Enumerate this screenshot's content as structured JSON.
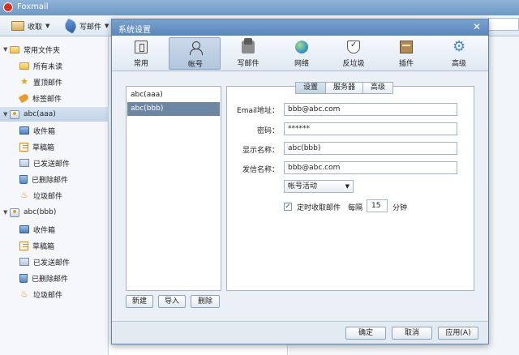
{
  "app": {
    "title": "Foxmail"
  },
  "toolbar": {
    "receive_label": "收取",
    "compose_label": "写邮件"
  },
  "sidebar": {
    "common_group": "常用文件夹",
    "common_items": [
      "所有未读",
      "置顶邮件",
      "标签邮件"
    ],
    "accounts": [
      {
        "name": "abc(aaa)",
        "folders": [
          "收件箱",
          "草稿箱",
          "已发送邮件",
          "已删除邮件",
          "垃圾邮件"
        ]
      },
      {
        "name": "abc(bbb)",
        "folders": [
          "收件箱",
          "草稿箱",
          "已发送邮件",
          "已删除邮件",
          "垃圾邮件"
        ]
      }
    ]
  },
  "dialog": {
    "title": "系统设置",
    "tabs": [
      {
        "label": "常用",
        "icon": "settings-common-icon"
      },
      {
        "label": "帐号",
        "icon": "account-icon"
      },
      {
        "label": "写邮件",
        "icon": "compose-icon"
      },
      {
        "label": "网络",
        "icon": "network-icon"
      },
      {
        "label": "反垃圾",
        "icon": "anti-spam-icon"
      },
      {
        "label": "插件",
        "icon": "plugin-icon"
      },
      {
        "label": "高级",
        "icon": "advanced-gear-icon"
      }
    ],
    "active_tab": "帐号",
    "account_list": [
      "abc(aaa)",
      "abc(bbb)"
    ],
    "selected_account": "abc(bbb)",
    "subtabs": [
      "设置",
      "服务器",
      "高级"
    ],
    "active_subtab": "设置",
    "form": {
      "email_label": "Email地址：",
      "email_value": "bbb@abc.com",
      "password_label": "密码：",
      "password_value": "******",
      "display_name_label": "显示名称：",
      "display_name_value": "abc(bbb)",
      "sender_name_label": "发信名称：",
      "sender_name_value": "bbb@abc.com",
      "status_select": "帐号活动",
      "auto_receive_checked": true,
      "auto_receive_label": "定时收取邮件",
      "every_label": "每隔",
      "interval_value": "15",
      "interval_unit": "分钟"
    },
    "list_buttons": {
      "new": "新建",
      "import": "导入",
      "delete": "删除"
    },
    "footer": {
      "ok": "确定",
      "cancel": "取消",
      "apply": "应用(A)"
    }
  }
}
